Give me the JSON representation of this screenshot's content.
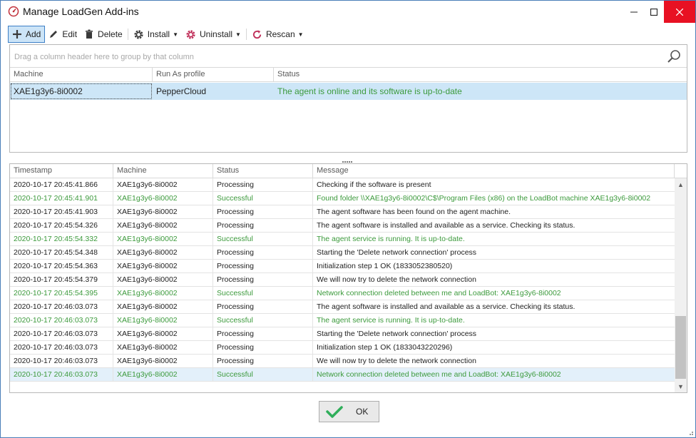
{
  "window": {
    "title": "Manage LoadGen Add-ins"
  },
  "toolbar": {
    "add_label": "Add",
    "edit_label": "Edit",
    "delete_label": "Delete",
    "install_label": "Install",
    "uninstall_label": "Uninstall",
    "rescan_label": "Rescan"
  },
  "agents_grid": {
    "group_hint": "Drag a column header here to group by that column",
    "columns": [
      "Machine",
      "Run As profile",
      "Status"
    ],
    "rows": [
      {
        "machine": "XAE1g3y6-8i0002",
        "profile": "PepperCloud",
        "status": "The agent is online and its software is up-to-date"
      }
    ]
  },
  "log_grid": {
    "columns": [
      "Timestamp",
      "Machine",
      "Status",
      "Message"
    ],
    "rows": [
      {
        "timestamp": "2020-10-17 20:45:41.866",
        "machine": "XAE1g3y6-8i0002",
        "status": "Processing",
        "message": "Checking if the software is present"
      },
      {
        "timestamp": "2020-10-17 20:45:41.901",
        "machine": "XAE1g3y6-8i0002",
        "status": "Successful",
        "message": "Found folder \\\\XAE1g3y6-8i0002\\C$\\Program Files (x86) on the LoadBot machine XAE1g3y6-8i0002"
      },
      {
        "timestamp": "2020-10-17 20:45:41.903",
        "machine": "XAE1g3y6-8i0002",
        "status": "Processing",
        "message": "The agent software has been found on the agent machine."
      },
      {
        "timestamp": "2020-10-17 20:45:54.326",
        "machine": "XAE1g3y6-8i0002",
        "status": "Processing",
        "message": "The agent software is installed and available as a service. Checking its status."
      },
      {
        "timestamp": "2020-10-17 20:45:54.332",
        "machine": "XAE1g3y6-8i0002",
        "status": "Successful",
        "message": "The agent service is running. It is up-to-date."
      },
      {
        "timestamp": "2020-10-17 20:45:54.348",
        "machine": "XAE1g3y6-8i0002",
        "status": "Processing",
        "message": "Starting the 'Delete network connection' process"
      },
      {
        "timestamp": "2020-10-17 20:45:54.363",
        "machine": "XAE1g3y6-8i0002",
        "status": "Processing",
        "message": "Initialization step 1 OK (1833052380520)"
      },
      {
        "timestamp": "2020-10-17 20:45:54.379",
        "machine": "XAE1g3y6-8i0002",
        "status": "Processing",
        "message": "We will now try to delete the network connection"
      },
      {
        "timestamp": "2020-10-17 20:45:54.395",
        "machine": "XAE1g3y6-8i0002",
        "status": "Successful",
        "message": "Network connection deleted between me and LoadBot: XAE1g3y6-8i0002"
      },
      {
        "timestamp": "2020-10-17 20:46:03.073",
        "machine": "XAE1g3y6-8i0002",
        "status": "Processing",
        "message": "The agent software is installed and available as a service. Checking its status."
      },
      {
        "timestamp": "2020-10-17 20:46:03.073",
        "machine": "XAE1g3y6-8i0002",
        "status": "Successful",
        "message": "The agent service is running. It is up-to-date."
      },
      {
        "timestamp": "2020-10-17 20:46:03.073",
        "machine": "XAE1g3y6-8i0002",
        "status": "Processing",
        "message": "Starting the 'Delete network connection' process"
      },
      {
        "timestamp": "2020-10-17 20:46:03.073",
        "machine": "XAE1g3y6-8i0002",
        "status": "Processing",
        "message": "Initialization step 1 OK (1833043220296)"
      },
      {
        "timestamp": "2020-10-17 20:46:03.073",
        "machine": "XAE1g3y6-8i0002",
        "status": "Processing",
        "message": "We will now try to delete the network connection"
      },
      {
        "timestamp": "2020-10-17 20:46:03.073",
        "machine": "XAE1g3y6-8i0002",
        "status": "Successful",
        "message": "Network connection deleted between me and LoadBot: XAE1g3y6-8i0002"
      }
    ],
    "selected_row": 14
  },
  "footer": {
    "ok_label": "OK"
  },
  "colors": {
    "success_text": "#3c9a3c",
    "selected_row": "#cde6f7",
    "accent": "#3d7fc6",
    "close_button": "#e81123"
  }
}
